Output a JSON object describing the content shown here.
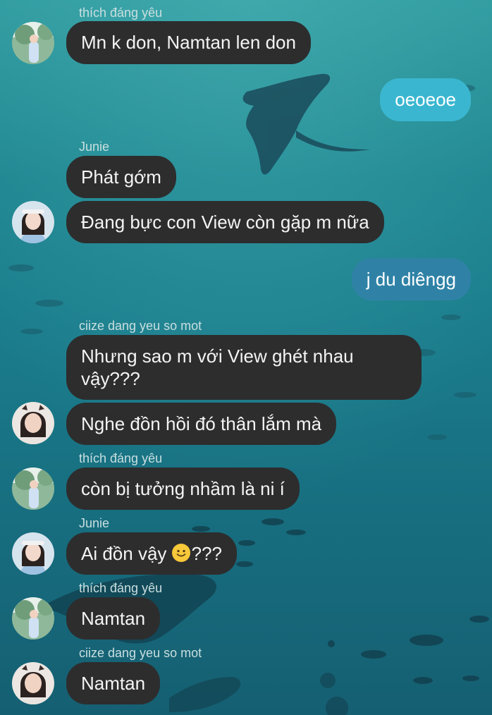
{
  "messages": [
    {
      "sender": "thích đáng yêu",
      "text": "Mn k don, Namtan len don"
    },
    {
      "text": "oeoeoe",
      "outgoing": true
    },
    {
      "sender": "Junie",
      "text": "Phát gớm"
    },
    {
      "text": "Đang bực con View còn gặp m nữa"
    },
    {
      "text": "j du diêngg",
      "outgoing": true
    },
    {
      "sender": "ciize dang yeu so mot",
      "text": "Nhưng sao m với View ghét nhau vậy???"
    },
    {
      "text": "Nghe đồn hồi đó thân lắm mà"
    },
    {
      "sender": "thích đáng yêu",
      "text": "còn bị tưởng nhầm là ni í"
    },
    {
      "sender": "Junie",
      "text_prefix": "Ai đồn vậy ",
      "emoji": "slightly-smiling-face",
      "text_suffix": "???"
    },
    {
      "sender": "thích đáng yêu",
      "text": "Namtan"
    },
    {
      "sender": "ciize dang yeu so mot",
      "text": "Namtan"
    }
  ],
  "colors": {
    "incoming_bubble": "#2d2d2e",
    "outgoing_bubble": "#3ab6d0",
    "outgoing_bubble_alt": "#2f82a6",
    "sender_name": "#c9dfe0"
  }
}
